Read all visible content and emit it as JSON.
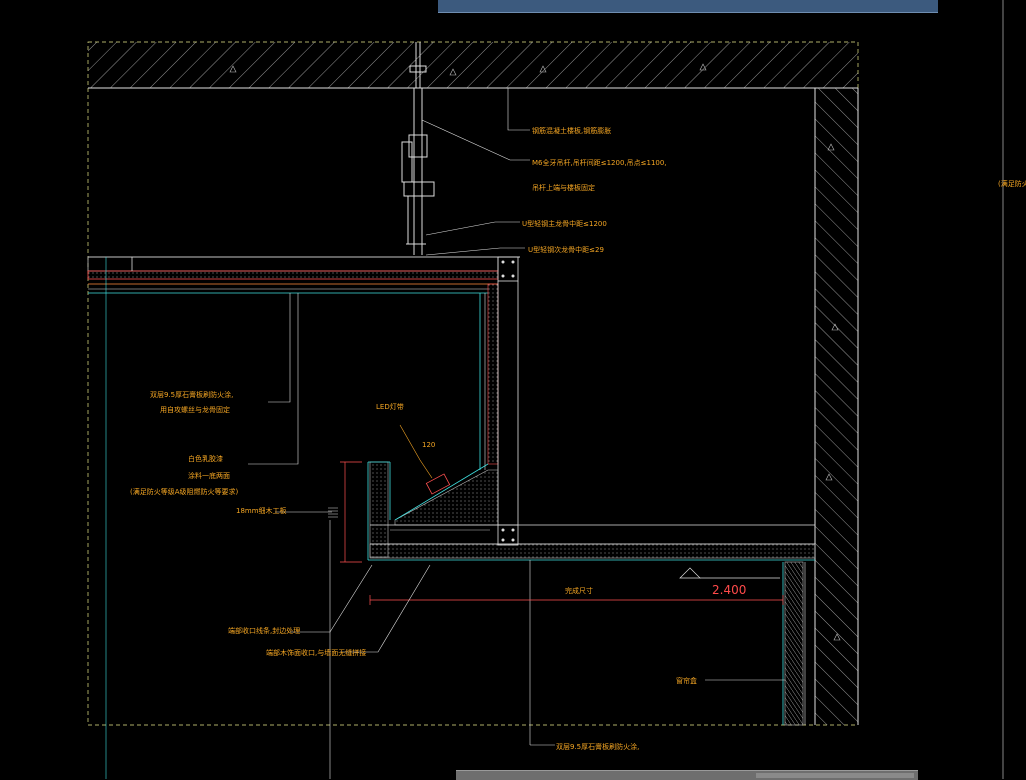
{
  "drawing": {
    "title_banner": "",
    "annotations": {
      "hanger_base": "钢筋混凝土楼板,钢筋膨胀",
      "hanger_rod": "M6全牙吊杆,吊杆间距≤1200,吊点≤1100,",
      "hanger_rod_2": "吊杆上端与楼板固定",
      "main_keel": "U型轻钢主龙骨中距≤1200",
      "secondary_keel": "U型轻钢次龙骨中距≤29",
      "gypsum_board": "双层9.5厚石膏板刷防火涂,",
      "gypsum_board_2": "用自攻螺丝与龙骨固定",
      "paint_1": "白色乳胶漆",
      "paint_2": "涂料一底两面",
      "paint_3": "(满足防火等级A级阻燃防火等要求)",
      "led": "LED灯带",
      "led_size": "120",
      "wood_board": "18mm细木工板",
      "edge_1": "端部收口线条,封边处理",
      "edge_2": "端部木饰面收口,与墙面无缝拼接",
      "finish_size": "完成尺寸",
      "elevation": "2.400",
      "curtain_box": "窗帘盒",
      "bottom_note": "双层9.5厚石膏板刷防火涂,",
      "right_note": "(满足防火等"
    }
  }
}
